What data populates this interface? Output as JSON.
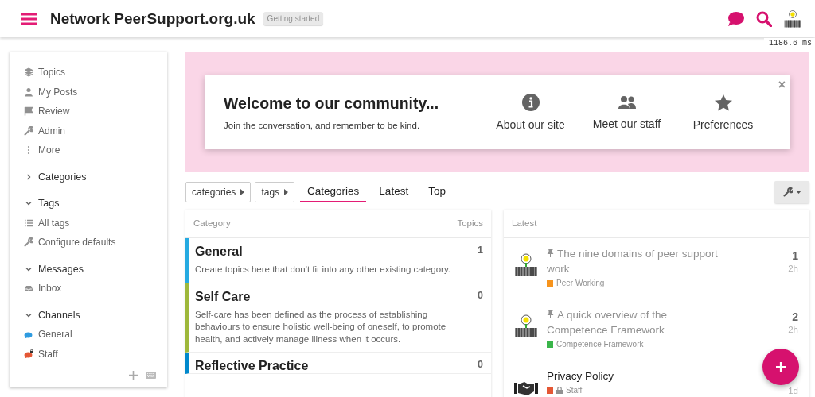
{
  "header": {
    "title": "Network PeerSupport.org.uk",
    "badge": "Getting started",
    "timing": "1186.6 ms"
  },
  "sidebar": {
    "items": [
      {
        "kind": "link",
        "label": "Topics"
      },
      {
        "kind": "link",
        "label": "My Posts"
      },
      {
        "kind": "link",
        "label": "Review"
      },
      {
        "kind": "link",
        "label": "Admin"
      },
      {
        "kind": "link",
        "label": "More"
      },
      {
        "kind": "section",
        "label": "Categories",
        "expanded": false
      },
      {
        "kind": "section",
        "label": "Tags",
        "expanded": true
      },
      {
        "kind": "link",
        "label": "All tags"
      },
      {
        "kind": "link",
        "label": "Configure defaults"
      },
      {
        "kind": "section",
        "label": "Messages",
        "expanded": true
      },
      {
        "kind": "link",
        "label": "Inbox"
      },
      {
        "kind": "section",
        "label": "Channels",
        "expanded": true
      },
      {
        "kind": "channel",
        "label": "General",
        "color": "#2e9be0",
        "locked": false
      },
      {
        "kind": "channel",
        "label": "Staff",
        "color": "#e45735",
        "locked": true
      }
    ]
  },
  "banner": {
    "title": "Welcome to our community...",
    "subtitle": "Join the conversation, and remember to be kind.",
    "links": [
      {
        "label": "About our site"
      },
      {
        "label": "Meet our staff"
      },
      {
        "label": "Preferences"
      }
    ],
    "close": "×"
  },
  "nav": {
    "dropdowns": [
      "categories",
      "tags"
    ],
    "tabs": [
      {
        "label": "Categories",
        "selected": true
      },
      {
        "label": "Latest",
        "selected": false
      },
      {
        "label": "Top",
        "selected": false
      }
    ]
  },
  "categories": {
    "columns": [
      "Category",
      "Topics"
    ],
    "rows": [
      {
        "name": "General",
        "description": "Create topics here that don't fit into any other existing category.",
        "topics": "1",
        "color": "#25aae1"
      },
      {
        "name": "Self Care",
        "description": "Self-care has been defined as the process of establishing behaviours to ensure holistic well-being of oneself, to promote health, and actively manage illness when it occurs.",
        "topics": "0",
        "color": "#9eb83b"
      },
      {
        "name": "Reflective Practice",
        "topics": "0",
        "color": "#0088cc"
      }
    ]
  },
  "latest": {
    "heading": "Latest",
    "topics": [
      {
        "pinned": true,
        "read": true,
        "title": "The nine domains of peer support work",
        "category": "Peer Working",
        "color": "#f7941d",
        "locked": false,
        "posts": "1",
        "age": "2h"
      },
      {
        "pinned": true,
        "read": true,
        "title": "A quick overview of the Competence Framework",
        "category": "Competence Framework",
        "color": "#3ab54a",
        "locked": false,
        "posts": "2",
        "age": "2h"
      },
      {
        "pinned": false,
        "read": false,
        "title": "Privacy Policy",
        "category": "Staff",
        "color": "#e45735",
        "locked": true,
        "age": "1d"
      }
    ]
  }
}
